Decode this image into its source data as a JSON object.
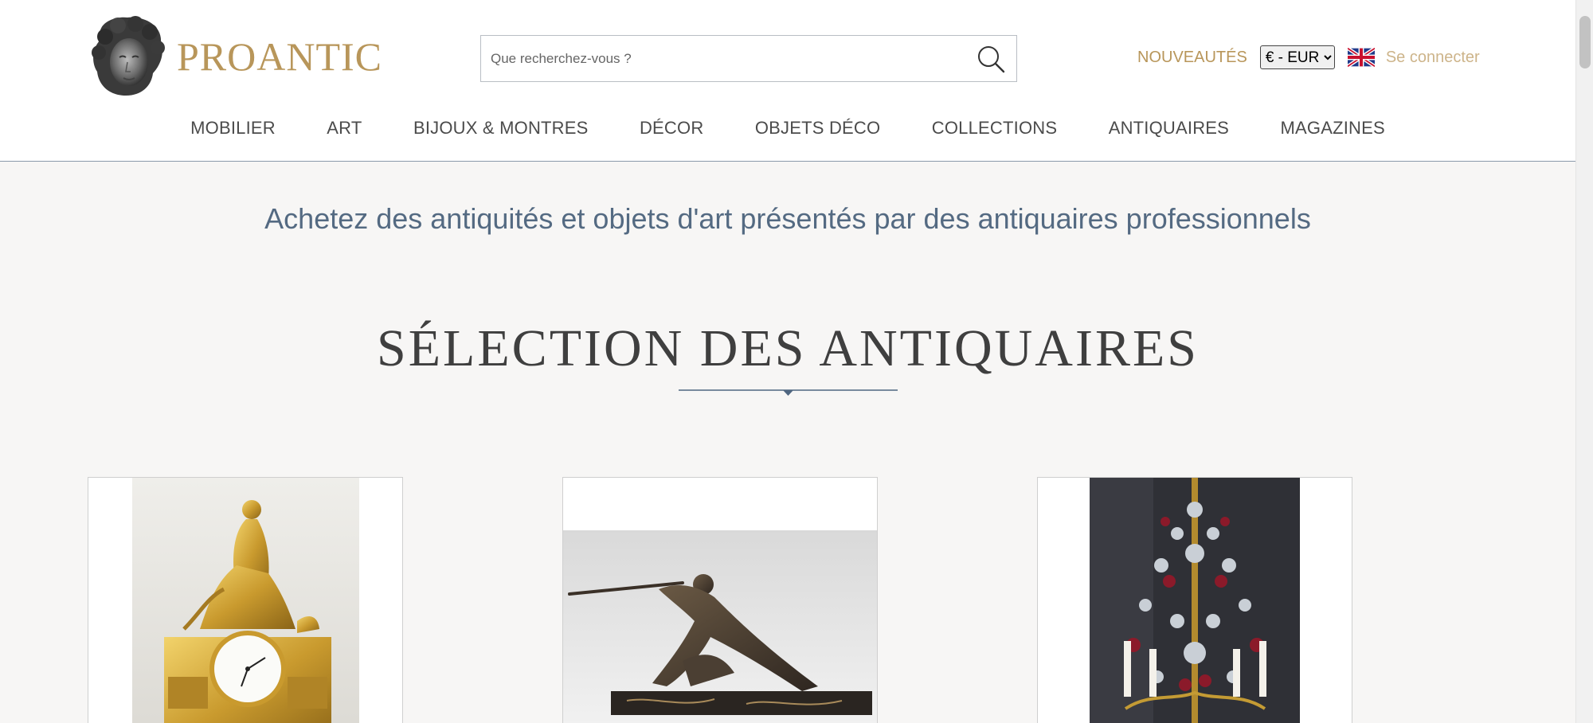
{
  "header": {
    "logo_text": "PROANTIC",
    "search_placeholder": "Que recherchez-vous ?",
    "nouveautes": "NOUVEAUTÉS",
    "currency": {
      "selected": "€ - EUR",
      "options": [
        "€ - EUR"
      ]
    },
    "login": "Se connecter",
    "icons": {
      "search": "search-icon",
      "flag": "uk-flag-icon",
      "logo": "statue-head-logo"
    }
  },
  "nav": {
    "items": [
      {
        "label": "MOBILIER"
      },
      {
        "label": "ART"
      },
      {
        "label": "BIJOUX & MONTRES"
      },
      {
        "label": "DÉCOR"
      },
      {
        "label": "OBJETS DÉCO"
      },
      {
        "label": "COLLECTIONS"
      },
      {
        "label": "ANTIQUAIRES"
      },
      {
        "label": "MAGAZINES"
      }
    ]
  },
  "main": {
    "tagline": "Achetez des antiquités et objets d'art présentés par des antiquaires professionnels",
    "section_title": "SÉLECTION DES ANTIQUAIRES"
  },
  "colors": {
    "brand_gold": "#b8965a",
    "login_gold": "#cdb48a",
    "tagline_blue": "#546a82",
    "divider": "#4f6680",
    "background": "#f7f6f5"
  }
}
